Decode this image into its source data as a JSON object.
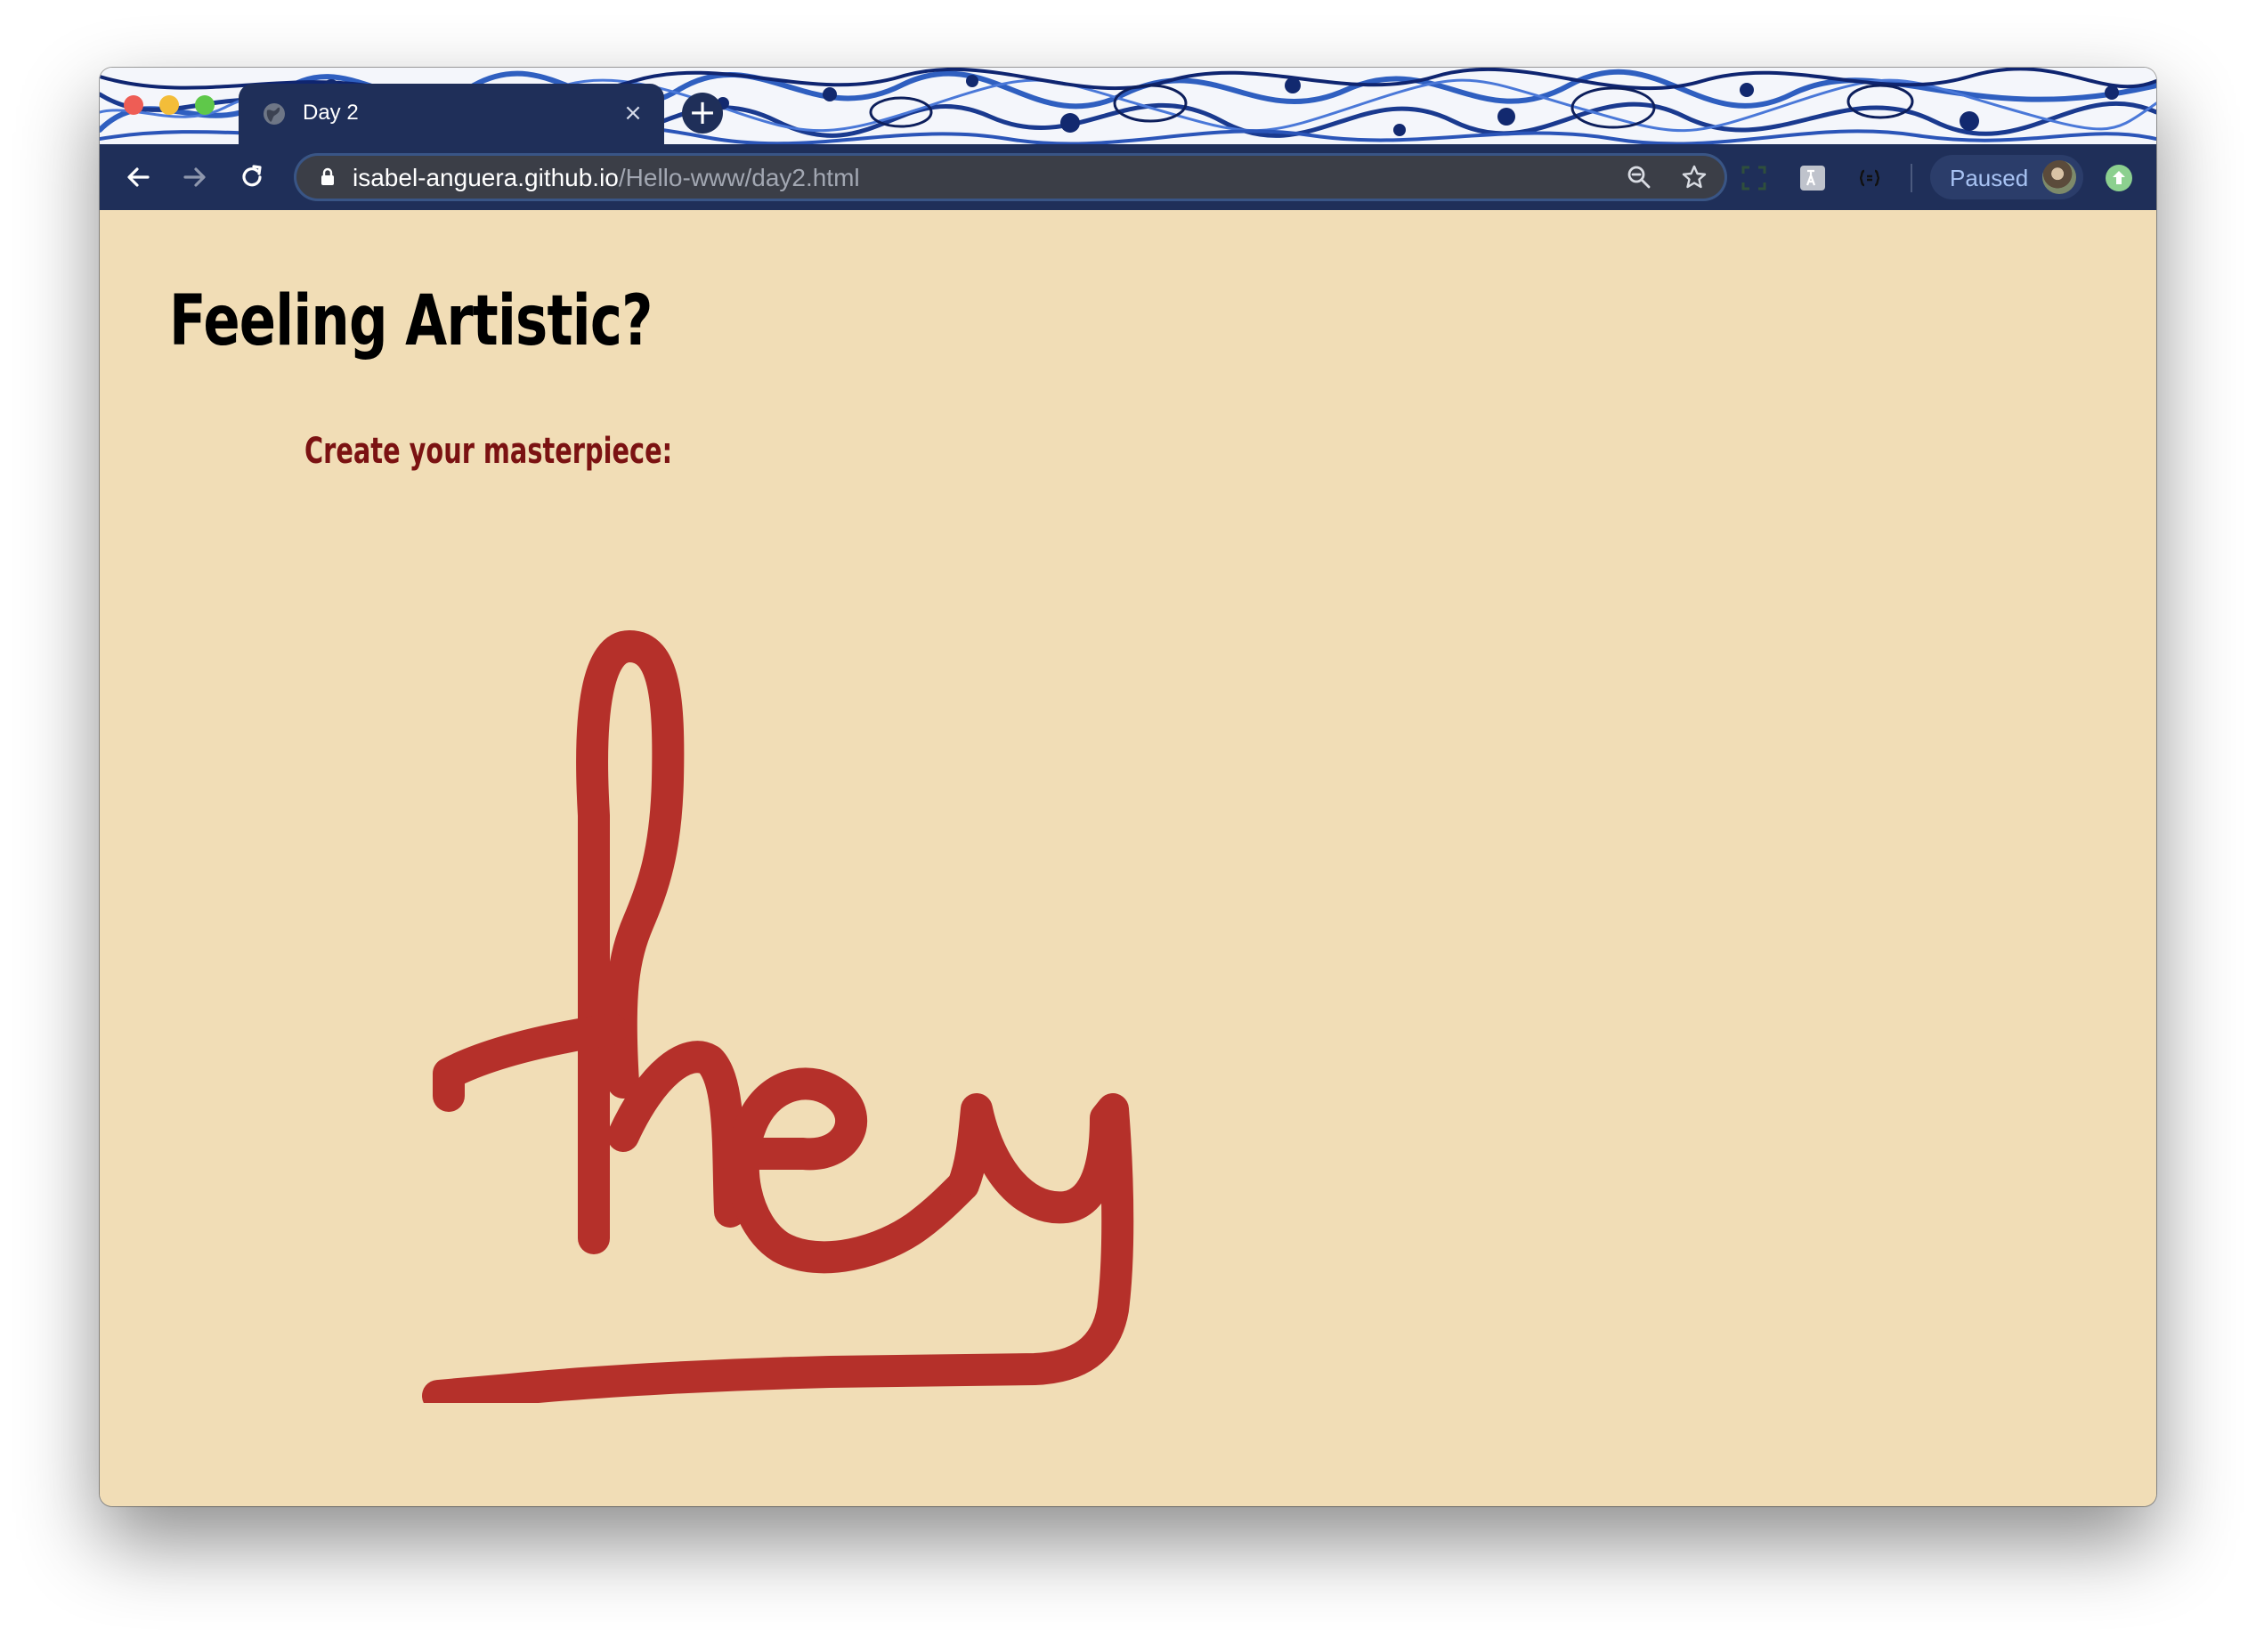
{
  "browser": {
    "tab": {
      "title": "Day 2",
      "close_glyph": "×",
      "favicon": "globe-icon"
    },
    "new_tab_glyph": "+",
    "address": {
      "host": "isabel-anguera.github.io",
      "path": "/Hello-www/day2.html",
      "secure_icon": "lock-icon"
    },
    "toolbar_icons": [
      "back-arrow-icon",
      "forward-arrow-icon",
      "reload-icon",
      "zoom-icon",
      "star-icon"
    ],
    "extensions": [
      "screenshot-extension-icon",
      "translate-extension-icon",
      "json-extension-icon"
    ],
    "profile": {
      "status_label": "Paused",
      "avatar": "profile-avatar"
    },
    "update_icon": "update-arrow-icon",
    "theme_colors": {
      "frame": "#1f2f59",
      "omnibox": "#3b3e47",
      "paused_text": "#a8c3f3"
    }
  },
  "page": {
    "title": "Feeling Artistic?",
    "subtitle": "Create your masterpiece:",
    "background_color": "#f1ddb6",
    "drawing": {
      "handwritten_text": "hey",
      "stroke_color": "#b5302a"
    }
  }
}
